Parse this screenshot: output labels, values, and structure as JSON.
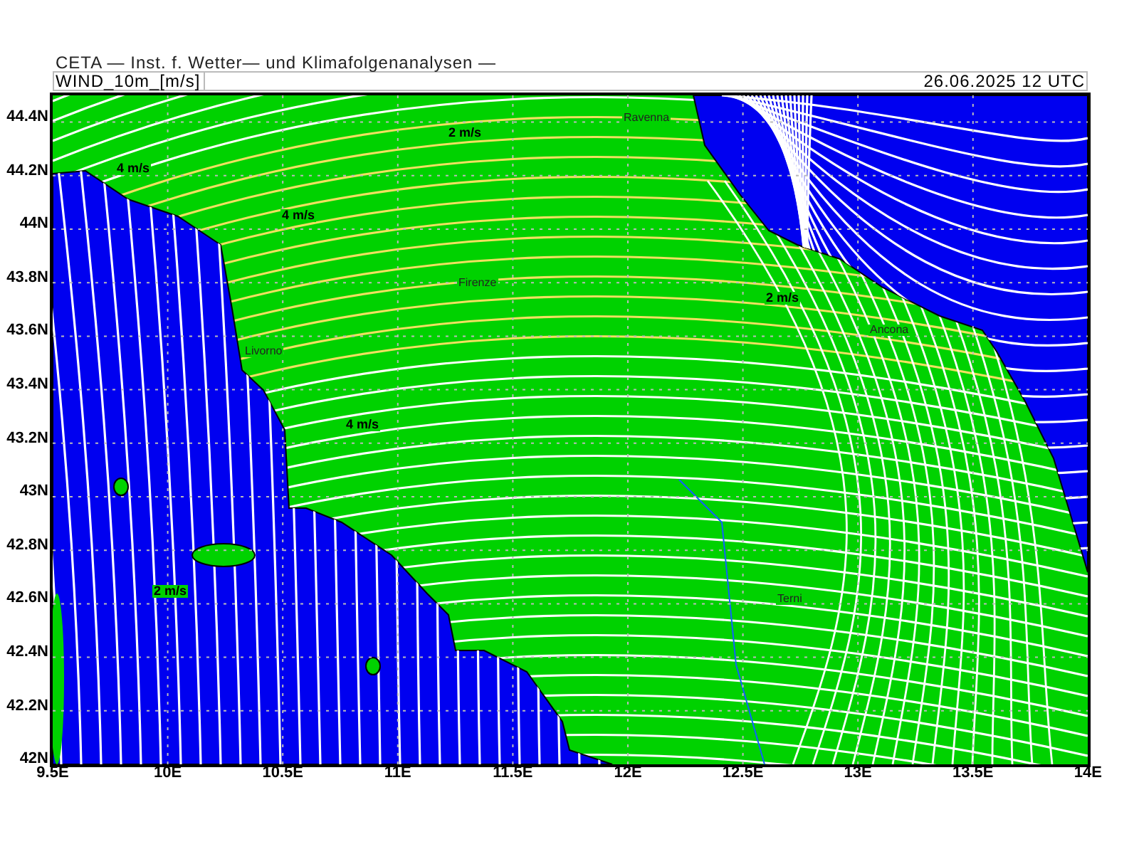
{
  "title": "CETA — Inst. f. Wetter— und Klimafolgenanalysen —",
  "header": {
    "field": "WIND_10m_[m/s]",
    "valid_time": "26.06.2025 12 UTC"
  },
  "map": {
    "places": [
      "Ravenna",
      "Firenze",
      "Livorno",
      "Ancona",
      "Terni"
    ],
    "speed_labels": [
      "4 m/s",
      "2 m/s",
      "4 m/s",
      "2 m/s",
      "4 m/s",
      "2 m/s"
    ],
    "y_ticks": [
      "44.4N",
      "44.2N",
      "44N",
      "43.8N",
      "43.6N",
      "43.4N",
      "43.2N",
      "43N",
      "42.8N",
      "42.6N",
      "42.4N",
      "42.2N",
      "42N"
    ],
    "x_ticks": [
      "9.5E",
      "10E",
      "10.5E",
      "11E",
      "11.5E",
      "12E",
      "12.5E",
      "13E",
      "13.5E",
      "14E"
    ]
  }
}
